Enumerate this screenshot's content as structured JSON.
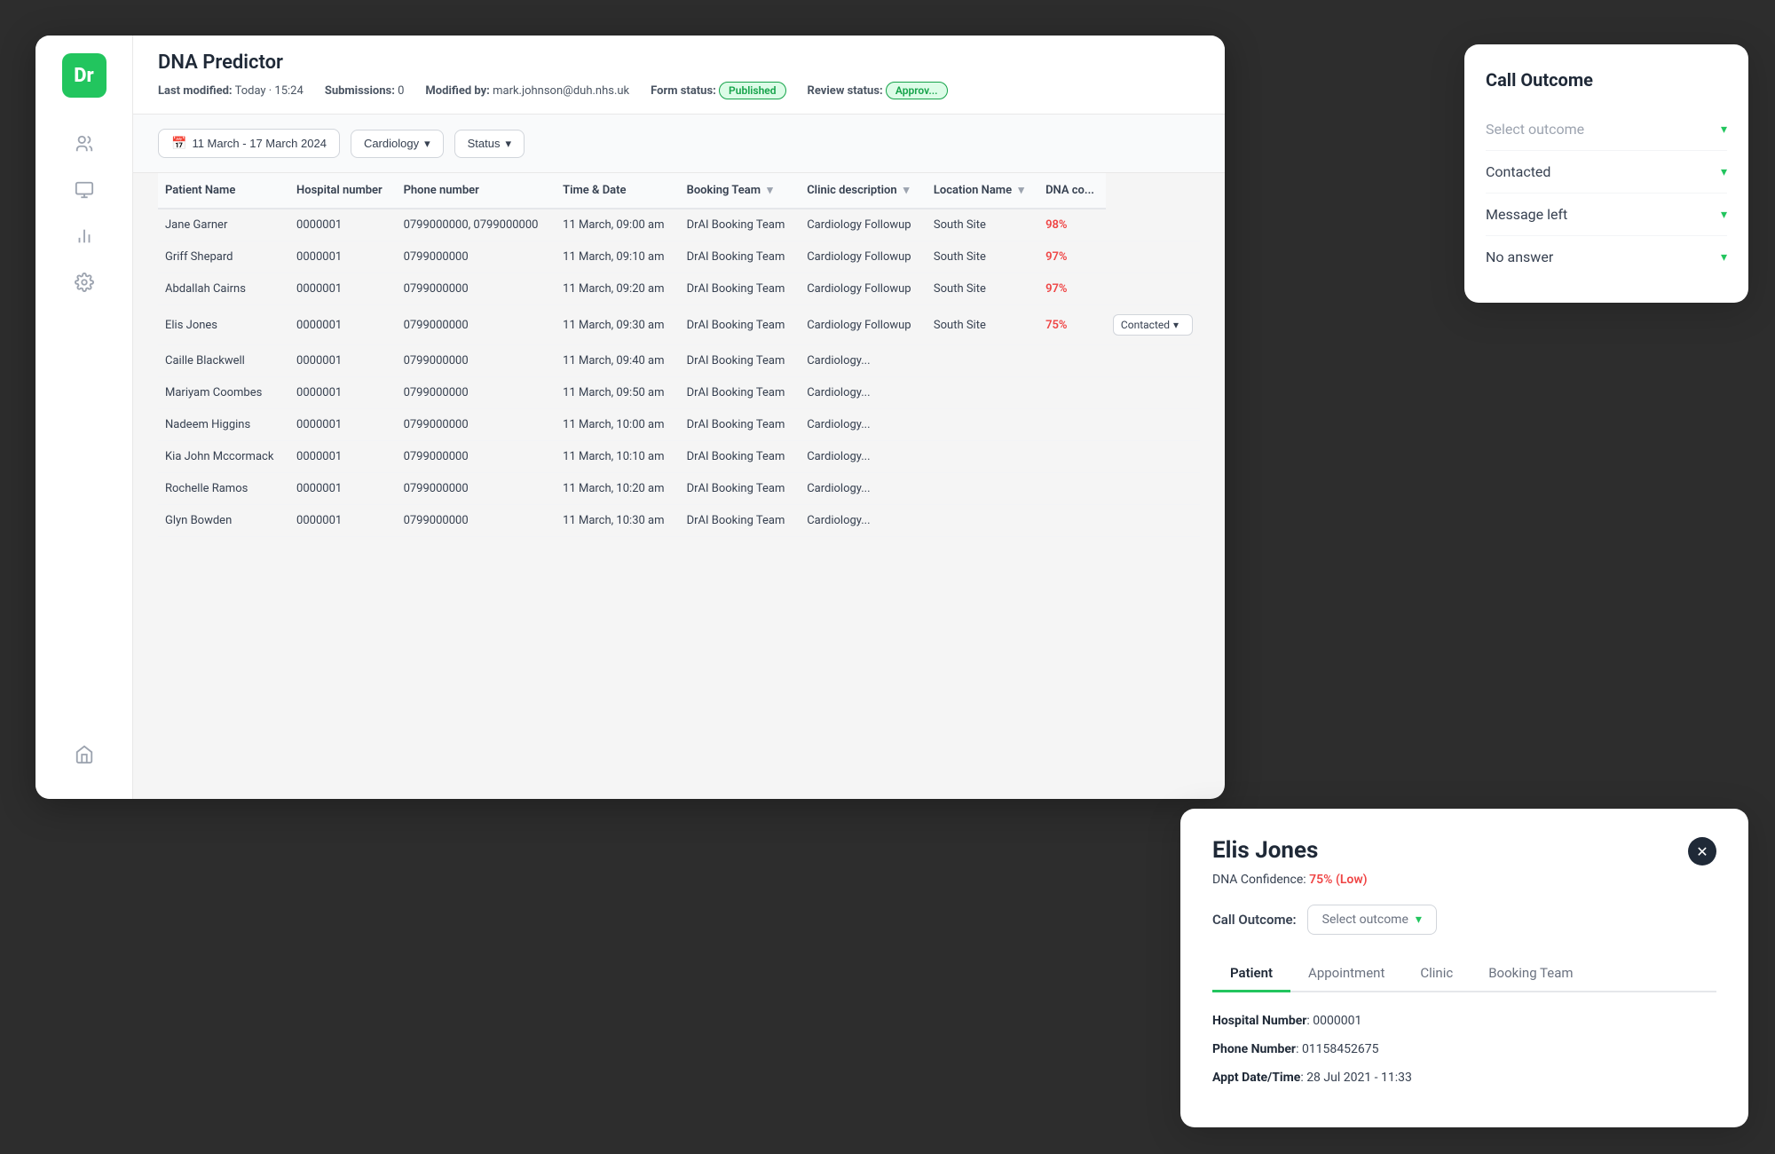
{
  "app": {
    "logo": "Dr",
    "title": "DNA Predictor"
  },
  "meta": {
    "last_modified_label": "Last modified:",
    "last_modified_value": "Today · 15:24",
    "submissions_label": "Submissions:",
    "submissions_value": "0",
    "modified_by_label": "Modified by:",
    "modified_by_value": "mark.johnson@duh.nhs.uk",
    "form_status_label": "Form status:",
    "form_status_value": "Published",
    "review_status_label": "Review status:",
    "review_status_value": "Approv..."
  },
  "filters": {
    "date_range": "11 March - 17 March 2024",
    "specialty": "Cardiology",
    "status": "Status"
  },
  "table": {
    "columns": [
      "Patient Name",
      "Hospital number",
      "Phone number",
      "Time & Date",
      "Booking Team",
      "Clinic description",
      "Location Name",
      "DNA co..."
    ],
    "rows": [
      {
        "name": "Jane Garner",
        "hospital": "0000001",
        "phone": "0799000000, 0799000000",
        "time": "11 March, 09:00 am",
        "team": "DrAI Booking Team",
        "clinic": "Cardiology Followup",
        "location": "South Site",
        "dna": "98%"
      },
      {
        "name": "Griff Shepard",
        "hospital": "0000001",
        "phone": "0799000000",
        "time": "11 March, 09:10 am",
        "team": "DrAI Booking Team",
        "clinic": "Cardiology Followup",
        "location": "South Site",
        "dna": "97%"
      },
      {
        "name": "Abdallah Cairns",
        "hospital": "0000001",
        "phone": "0799000000",
        "time": "11 March, 09:20 am",
        "team": "DrAI Booking Team",
        "clinic": "Cardiology Followup",
        "location": "South Site",
        "dna": "97%"
      },
      {
        "name": "Elis Jones",
        "hospital": "0000001",
        "phone": "0799000000",
        "time": "11 March, 09:30 am",
        "team": "DrAI Booking Team",
        "clinic": "Cardiology Followup",
        "location": "South Site",
        "dna": "75%",
        "outcome": "Contacted"
      },
      {
        "name": "Caille Blackwell",
        "hospital": "0000001",
        "phone": "0799000000",
        "time": "11 March, 09:40 am",
        "team": "DrAI Booking Team",
        "clinic": "Cardiology...",
        "location": "",
        "dna": ""
      },
      {
        "name": "Mariyam Coombes",
        "hospital": "0000001",
        "phone": "0799000000",
        "time": "11 March, 09:50 am",
        "team": "DrAI Booking Team",
        "clinic": "Cardiology...",
        "location": "",
        "dna": ""
      },
      {
        "name": "Nadeem Higgins",
        "hospital": "0000001",
        "phone": "0799000000",
        "time": "11 March, 10:00 am",
        "team": "DrAI Booking Team",
        "clinic": "Cardiology...",
        "location": "",
        "dna": ""
      },
      {
        "name": "Kia John Mccormack",
        "hospital": "0000001",
        "phone": "0799000000",
        "time": "11 March, 10:10 am",
        "team": "DrAI Booking Team",
        "clinic": "Cardiology...",
        "location": "",
        "dna": ""
      },
      {
        "name": "Rochelle Ramos",
        "hospital": "0000001",
        "phone": "0799000000",
        "time": "11 March, 10:20 am",
        "team": "DrAI Booking Team",
        "clinic": "Cardiology...",
        "location": "",
        "dna": ""
      },
      {
        "name": "Glyn Bowden",
        "hospital": "0000001",
        "phone": "0799000000",
        "time": "11 March, 10:30 am",
        "team": "DrAI Booking Team",
        "clinic": "Cardiology...",
        "location": "",
        "dna": ""
      }
    ]
  },
  "call_outcome_panel": {
    "title": "Call Outcome",
    "placeholder": "Select outcome",
    "options": [
      {
        "label": "Contacted"
      },
      {
        "label": "Message left"
      },
      {
        "label": "No answer"
      }
    ]
  },
  "patient_panel": {
    "name": "Elis Jones",
    "dna_label": "DNA Confidence:",
    "dna_value": "75% (Low)",
    "call_outcome_label": "Call Outcome:",
    "call_outcome_placeholder": "Select outcome",
    "tabs": [
      "Patient",
      "Appointment",
      "Clinic",
      "Booking Team"
    ],
    "active_tab": "Patient",
    "hospital_number_label": "Hospital Number",
    "hospital_number_value": "0000001",
    "phone_number_label": "Phone Number",
    "phone_number_value": "01158452675",
    "appt_datetime_label": "Appt Date/Time",
    "appt_datetime_value": "28 Jul 2021 - 11:33"
  },
  "icons": {
    "users": "👥",
    "chart_bar": "📊",
    "chart_line": "📈",
    "settings": "⚙",
    "home": "🏠",
    "chevron_down": "▾",
    "calendar": "📅",
    "close": "✕",
    "collapse": "«"
  }
}
